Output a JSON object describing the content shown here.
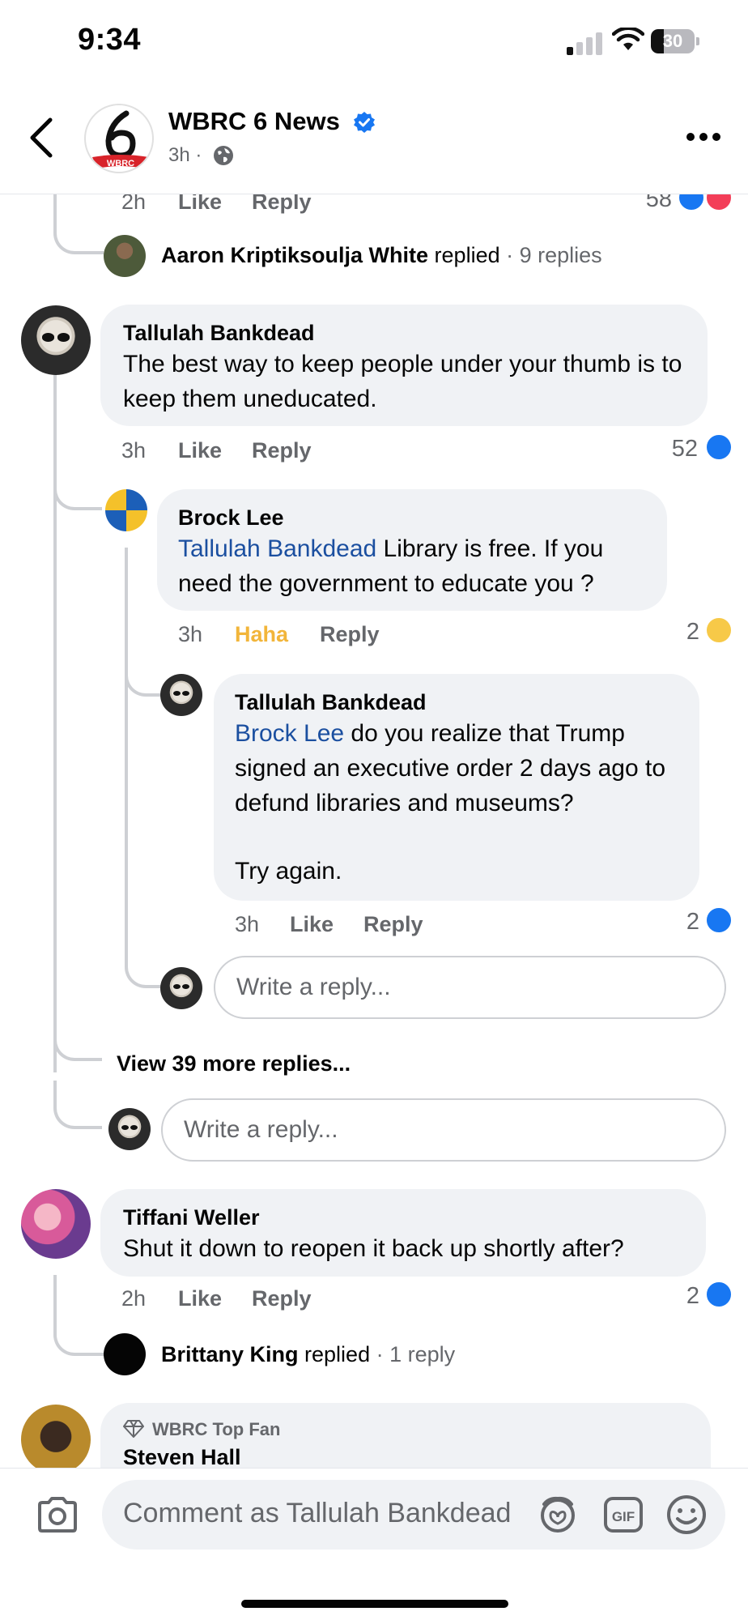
{
  "status_bar": {
    "time": "9:34",
    "battery": "30",
    "battery_level": 0.3
  },
  "header": {
    "page_name": "WBRC 6 News",
    "meta": "3h ·",
    "logo_text": "WBRC"
  },
  "top_partial": {
    "time": "2h",
    "like": "Like",
    "reply": "Reply",
    "count": "58"
  },
  "aaron_summary": {
    "name": "Aaron Kriptiksoulja White",
    "replied": "replied",
    "count": "· 9 replies"
  },
  "comments": {
    "tallulah_1": {
      "author": "Tallulah Bankdead",
      "text": "The best way to keep people under your thumb is to keep them uneducated.",
      "time": "3h",
      "like": "Like",
      "reply": "Reply",
      "count": "52"
    },
    "brock": {
      "author": "Brock Lee",
      "mention": "Tallulah Bankdead",
      "text": " Library is free. If you need the government to educate you ?",
      "time": "3h",
      "reaction": "Haha",
      "reply": "Reply",
      "count": "2"
    },
    "tallulah_2": {
      "author": "Tallulah Bankdead",
      "mention": "Brock Lee",
      "text": " do you realize that Trump signed an executive order 2 days ago to defund libraries and museums?",
      "text2": "Try again.",
      "time": "3h",
      "like": "Like",
      "reply": "Reply",
      "count": "2"
    },
    "tiffani": {
      "author": "Tiffani Weller",
      "text": "Shut it down to reopen it back up shortly after?",
      "time": "2h",
      "like": "Like",
      "reply": "Reply",
      "count": "2"
    },
    "steven": {
      "badge": "WBRC Top Fan",
      "author": "Steven Hall"
    }
  },
  "write_reply_placeholder": "Write a reply...",
  "view_more": "View 39 more replies...",
  "brittany_summary": {
    "name": "Brittany King",
    "replied": "replied",
    "count": "· 1 reply"
  },
  "composer": {
    "placeholder": "Comment as Tallulah Bankdead"
  },
  "colors": {
    "link": "#1b4fa0",
    "like_blue": "#1877f2",
    "haha": "#f2b53a",
    "bubble": "#f0f2f5"
  }
}
